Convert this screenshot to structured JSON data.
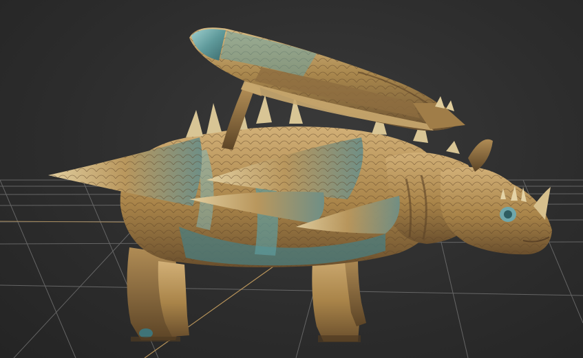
{
  "viewport": {
    "subject": "armored-rhino-creature-with-rocket-pod",
    "grid_visible": true
  },
  "colors": {
    "background": "#2d2d2d",
    "grid": "#7d7d7d",
    "axis": "#c8a060",
    "skin_base": "#b08a52",
    "skin_shadow": "#6f5330",
    "skin_highlight": "#d9b87c",
    "armor_teal": "#4f8a8c",
    "armor_teal_light": "#8cc3c4"
  }
}
